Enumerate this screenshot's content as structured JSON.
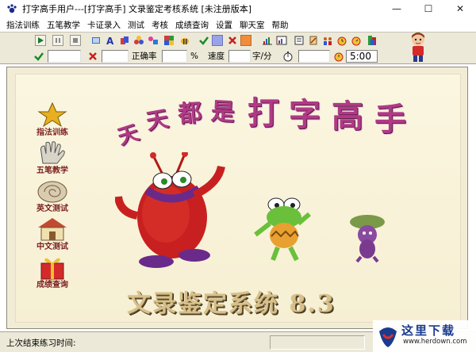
{
  "window": {
    "title": "打字高手用户---[打字高手]    文录鉴定考核系统 [未注册版本]",
    "buttons": {
      "minimize": "—",
      "maximize": "☐",
      "close": "✕"
    }
  },
  "menu": [
    "指法训练",
    "五笔教学",
    "卡证录入",
    "测试",
    "考核",
    "成绩查询",
    "设置",
    "聊天室",
    "帮助"
  ],
  "toolbar": {
    "accuracy_label": "正确率",
    "percent_unit": "%",
    "speed_label": "速度",
    "speed_unit": "字/分",
    "timer_value": "5:00"
  },
  "sidebar": [
    {
      "label": "指法训练",
      "icon": "star-icon"
    },
    {
      "label": "五笔教学",
      "icon": "hand-icon"
    },
    {
      "label": "英文测试",
      "icon": "shell-icon"
    },
    {
      "label": "中文测试",
      "icon": "house-icon"
    },
    {
      "label": "成绩查询",
      "icon": "gift-icon"
    }
  ],
  "banner": {
    "headline_chars": [
      "天",
      "天",
      "都",
      "是",
      "打",
      "字",
      "高",
      "手"
    ],
    "system_title": "文录鉴定系统 8.3"
  },
  "status": {
    "last_practice_label": "上次结束练习时间:"
  },
  "watermark": {
    "text": "这里下载",
    "url": "www.herdown.com"
  },
  "colors": {
    "headline": "#b03a86",
    "system_title": "#d8c08a",
    "nav_label": "#7a1f1f",
    "background": "#f6efd3"
  }
}
